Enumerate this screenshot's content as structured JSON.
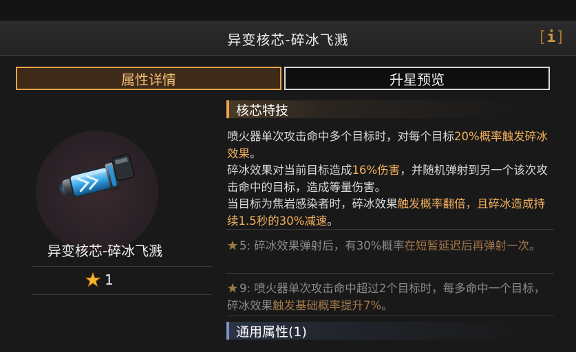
{
  "header": {
    "title": "异变核芯-碎冰飞溅",
    "info_label": "i"
  },
  "tabs": [
    {
      "label": "属性详情",
      "active": true
    },
    {
      "label": "升星预览",
      "active": false
    }
  ],
  "item": {
    "name": "异变核芯-碎冰飞溅",
    "stars": "1"
  },
  "sections": {
    "core_skill": "核芯特技",
    "general": "通用属性(1)"
  },
  "description": {
    "l1a": "喷火器单次攻击命中多个目标时，对每个目标",
    "l1b": "20%概率触发碎冰效果",
    "l1c": "。",
    "l2a": "碎冰效果对当前目标造成",
    "l2b": "16%伤害",
    "l2c": "，并随机弹射到另一个该次攻击命中的目标，造成等量伤害。",
    "l3a": "当目标为焦岩感染者时，碎冰效果",
    "l3b": "触发概率翻倍，且碎冰造成持续1.5秒的30%减速",
    "l3c": "。"
  },
  "upgrades": [
    {
      "level": "5:",
      "a": " 碎冰效果弹射后，有30%概率",
      "b": "在短暂延迟后再弹射一次",
      "c": "。"
    },
    {
      "level": "9:",
      "a": " 喷火器单次攻击命中超过2个目标时，每多命中一个目标，碎冰效果",
      "b": "触发基础概率提升7%",
      "c": "。"
    }
  ],
  "colors": {
    "accent": "#f0a54d",
    "highlight": "#f4b05c",
    "general_bar": "#7c93c5"
  }
}
